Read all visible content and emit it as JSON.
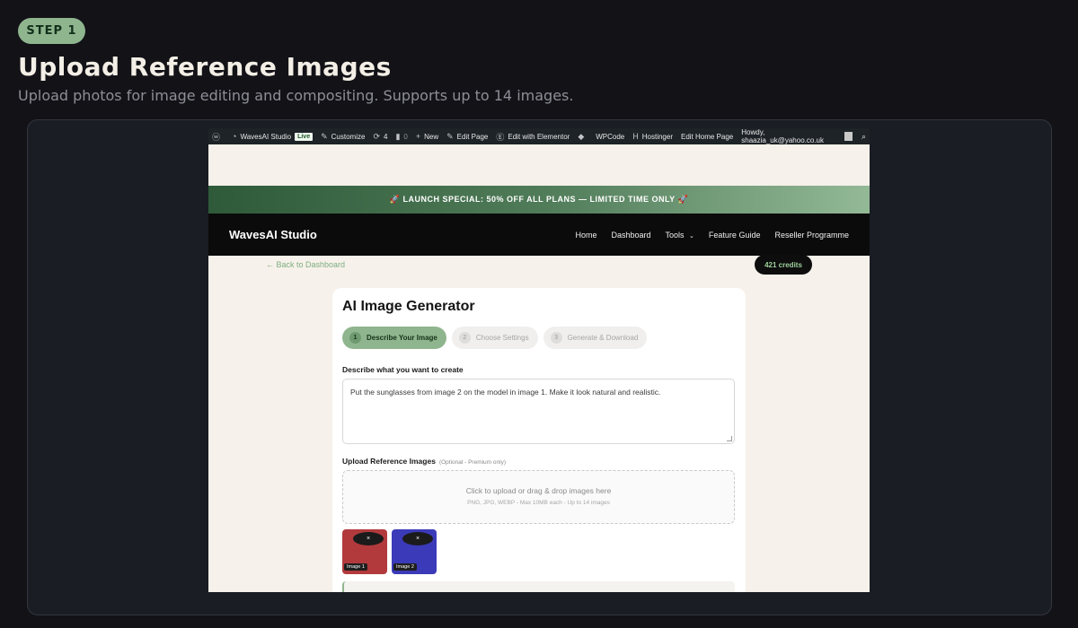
{
  "page": {
    "step_badge": "STEP 1",
    "title": "Upload Reference Images",
    "subtitle": "Upload photos for image editing and compositing. Supports up to 14 images."
  },
  "adminbar": {
    "site_name": "WavesAI Studio",
    "live_label": "Live",
    "customize": "Customize",
    "updates_count": "4",
    "comments_count": "0",
    "new_label": "New",
    "edit_page": "Edit Page",
    "edit_elementor": "Edit with Elementor",
    "wpcode": "WPCode",
    "hostinger": "Hostinger",
    "edit_home": "Edit Home Page",
    "howdy": "Howdy, shaazia_uk@yahoo.co.uk"
  },
  "promo": {
    "text": "🚀 LAUNCH SPECIAL: 50% OFF ALL PLANS — LIMITED TIME ONLY 🚀"
  },
  "nav": {
    "brand": "WavesAI Studio",
    "links": [
      "Home",
      "Dashboard",
      "Tools",
      "Feature Guide",
      "Reseller Programme"
    ]
  },
  "toolbar": {
    "back": "← Back to Dashboard",
    "credits": "421 credits"
  },
  "card": {
    "title": "AI Image Generator",
    "steps": [
      {
        "num": "1",
        "label": "Describe Your Image"
      },
      {
        "num": "2",
        "label": "Choose Settings"
      },
      {
        "num": "3",
        "label": "Generate & Download"
      }
    ],
    "describe_label": "Describe what you want to create",
    "prompt_value": "Put the sunglasses from image 2 on the model in image 1. Make it look natural and realistic.",
    "upload_label": "Upload Reference Images",
    "upload_optional": "(Optional - Premium only)",
    "dropzone_main": "Click to upload or drag & drop images here",
    "dropzone_sub": "PNG, JPG, WEBP - Max 10MB each - Up to 14 images",
    "thumbs": [
      {
        "label": "Image 1",
        "remove": "×",
        "color": "#b23a3d"
      },
      {
        "label": "Image 2",
        "remove": "×",
        "color": "#3b3ab8"
      }
    ]
  },
  "colors": {
    "accent": "#8fb58e",
    "background": "#121217",
    "navbar": "#0b0b0b"
  }
}
